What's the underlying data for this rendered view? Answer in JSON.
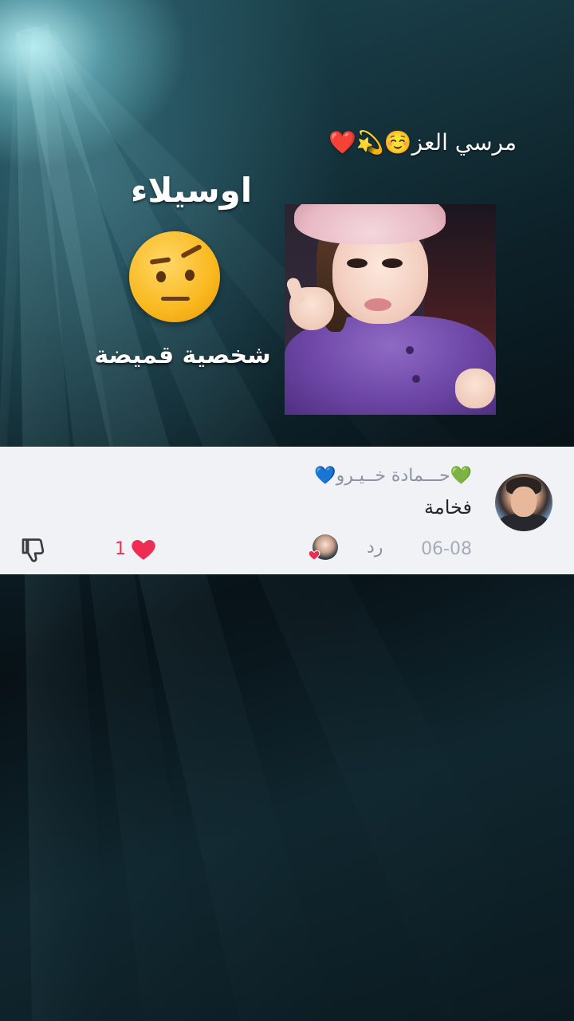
{
  "video": {
    "caption_top": "مرسي العز☺️💫❤️",
    "overlay_name": "اوسيلاء",
    "overlay_subtitle": "شخصية قميضة"
  },
  "comment": {
    "username": "💚حـــمادة خــيـرو💙",
    "text": "فخامة",
    "date": "06-08",
    "reply_label": "رد",
    "like_count": "1"
  },
  "icons": {
    "face_emoji": "face-with-raised-eyebrow-icon",
    "creator_liked": "creator-heart-icon",
    "like": "heart-icon",
    "dislike": "thumbs-down-icon"
  },
  "colors": {
    "card_bg": "#f1f2f6",
    "like_red": "#ee2d54",
    "username_gray": "#8a93a3"
  }
}
